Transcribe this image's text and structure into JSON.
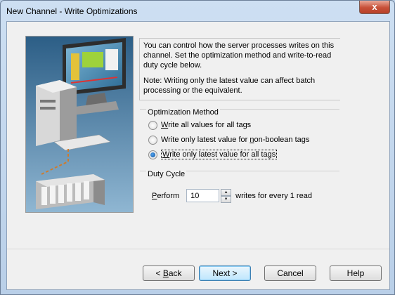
{
  "window": {
    "title": "New Channel - Write Optimizations",
    "close_glyph": "x"
  },
  "info": {
    "text": "You can control how the server processes writes on this channel.  Set the optimization method and write-to-read duty cycle below.",
    "note": "Note:  Writing only the latest value can affect batch processing or the equivalent."
  },
  "optimization": {
    "label": "Optimization Method",
    "options": [
      {
        "pre": "",
        "key": "W",
        "post": "rite all values for all tags",
        "selected": false
      },
      {
        "pre": "Write only latest value for ",
        "key": "n",
        "post": "on-boolean tags",
        "selected": false
      },
      {
        "pre": "",
        "key": "W",
        "post": "rite only latest value for all tags",
        "selected": true
      }
    ]
  },
  "duty": {
    "label": "Duty Cycle",
    "perform_key": "P",
    "perform_rest": "erform",
    "value": "10",
    "suffix": "writes for every 1 read"
  },
  "buttons": {
    "back_pre": "< ",
    "back_key": "B",
    "back_post": "ack",
    "next": "Next >",
    "cancel": "Cancel",
    "help": "Help"
  },
  "icons": {
    "radio": "radio-button-icon",
    "spinner": "spin-arrows-icon",
    "illustration": "computer-and-plc-illustration"
  }
}
